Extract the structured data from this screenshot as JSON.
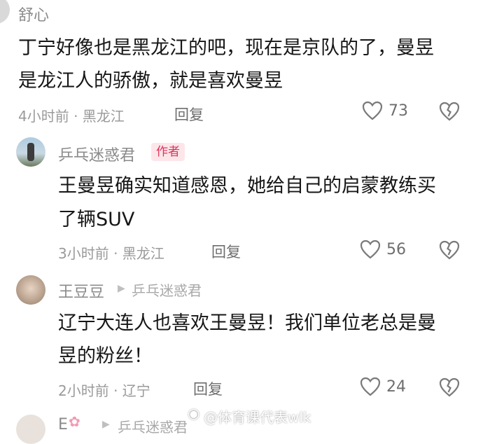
{
  "comments": [
    {
      "username": "舒心",
      "text_lines": [
        "丁宁好像也是黑龙江的吧，现在是京队的了，曼昱",
        "是龙江人的骄傲，就是喜欢曼昱"
      ],
      "meta": "4小时前 · 黑龙江",
      "reply_label": "回复",
      "likes": "73"
    },
    {
      "username": "乒乓迷惑君",
      "badge": "作者",
      "text_lines": [
        "王曼昱确实知道感恩，她给自己的启蒙教练买",
        "了辆SUV"
      ],
      "meta": "3小时前 · 黑龙江",
      "reply_label": "回复",
      "likes": "56"
    },
    {
      "username": "王豆豆",
      "reply_to": "乒乓迷惑君",
      "text_lines": [
        "辽宁大连人也喜欢王曼昱！我们单位老总是曼",
        "昱的粉丝！"
      ],
      "meta": "2小时前 · 辽宁",
      "reply_label": "回复",
      "likes": "24"
    },
    {
      "username": "E",
      "reply_to": "乒乓迷惑君"
    }
  ],
  "watermark": "@体育课代表wlk",
  "colors": {
    "badge_bg": "#fde6ea",
    "badge_text": "#e0335a",
    "meta": "#9a9a9a",
    "text": "#161616"
  }
}
